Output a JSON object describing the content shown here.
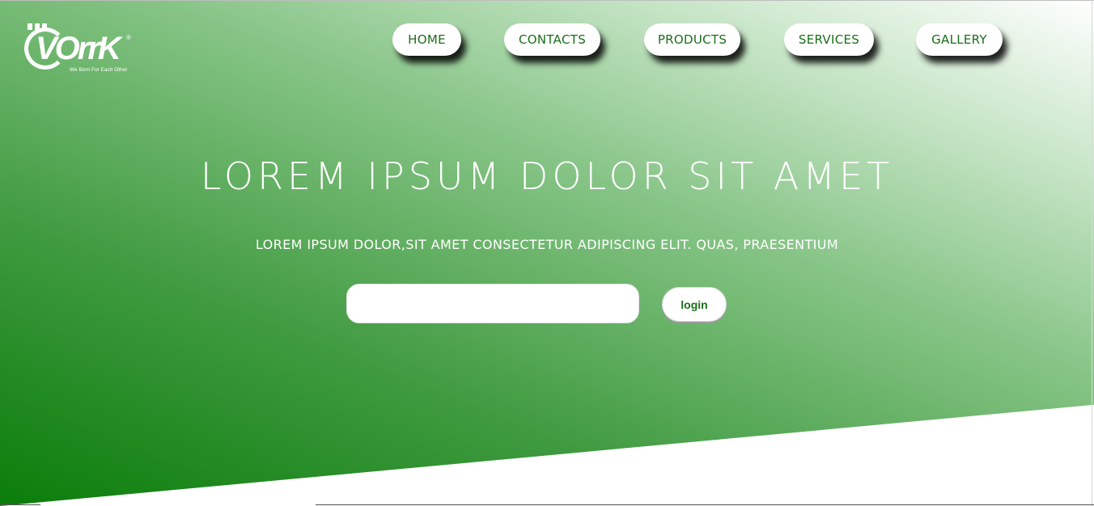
{
  "logo": {
    "text": "VOrrK",
    "registered": "®",
    "tagline": "We Born For Each Other"
  },
  "nav": {
    "items": [
      {
        "label": "HOME"
      },
      {
        "label": "CONTACTS"
      },
      {
        "label": "PRODUCTS"
      },
      {
        "label": "SERVICES"
      },
      {
        "label": "GALLERY"
      }
    ]
  },
  "hero": {
    "title": "LOREM IPSUM DOLOR SIT AMET",
    "subtitle": "LOREM IPSUM DOLOR,SIT AMET CONSECTETUR ADIPISCING ELIT. QUAS, PRAESENTIUM",
    "input_value": "",
    "input_placeholder": "",
    "login_label": "login"
  },
  "colors": {
    "accent_green": "#1a6e1a",
    "gradient_dark": "#0a7d0a",
    "gradient_light": "#c9e6c9",
    "white": "#ffffff"
  }
}
